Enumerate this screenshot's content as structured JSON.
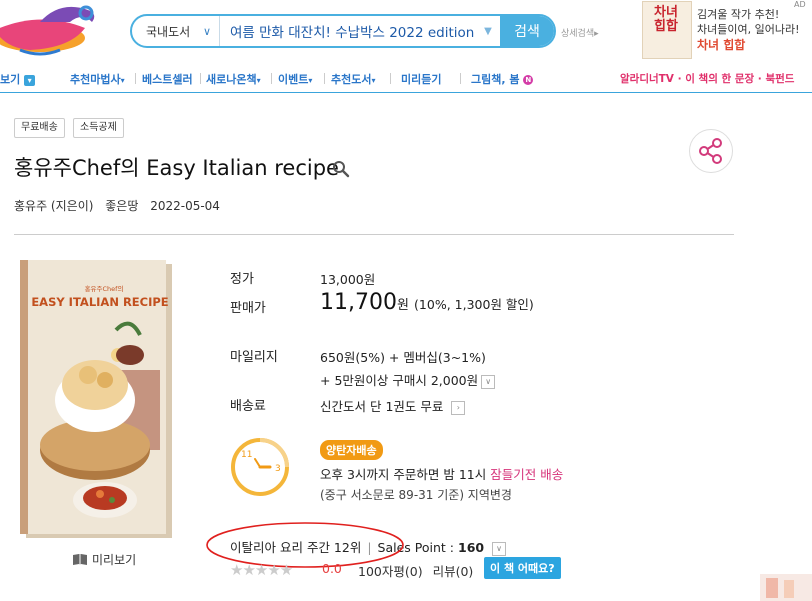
{
  "header": {
    "search": {
      "category": "국내도서",
      "value": "여름 만화 대잔치! 수납박스 2022 edition!",
      "button_label": "검색",
      "detail_label": "상세검색"
    },
    "ad": {
      "cover_text": "차녀 힙합",
      "line1": "김겨울 작가 추천!",
      "line2": "차녀들이여, 일어나라!",
      "title": "차녀 힙합",
      "mark": "AD"
    }
  },
  "nav": {
    "items": [
      {
        "label": "보기"
      },
      {
        "label": "추천마법사"
      },
      {
        "label": "베스트셀러"
      },
      {
        "label": "새로나온책"
      },
      {
        "label": "이벤트"
      },
      {
        "label": "추천도서"
      },
      {
        "label": "미리듣기"
      },
      {
        "label": "그림책, 봄"
      }
    ],
    "right_text": "알라디너TV · 이 책의 한 문장 · 북펀드"
  },
  "product": {
    "tags": [
      "무료배송",
      "소득공제"
    ],
    "title": "홍유주Chef의 Easy Italian recipe",
    "author": "홍유주 (지은이)",
    "publisher": "좋은땅",
    "date": "2022-05-04",
    "cover": {
      "small_title": "홍유주Chef의",
      "main_title": "EASY ITALIAN RECIPE"
    },
    "preview_label": "미리보기",
    "price": {
      "list_label": "정가",
      "list_value": "13,000원",
      "sale_label": "판매가",
      "sale_value": "11,700",
      "sale_unit": "원",
      "sale_discount": "(10%, 1,300원 할인)"
    },
    "mileage": {
      "label": "마일리지",
      "line1": "650원(5%) + 멤버십(3~1%)",
      "line2": "+ 5만원이상 구매시 2,000원"
    },
    "shipping": {
      "label": "배송료",
      "value": "신간도서 단 1권도 무료"
    },
    "delivery": {
      "badge": "양탄자배송",
      "line1_prefix": "오후 3시까지 주문하면 밤 11시 ",
      "line1_highlight": "잠들기전 배송",
      "line2": "(중구 서소문로 89-31 기준) 지역변경",
      "clock_11": "11",
      "clock_3": "3"
    },
    "rank": {
      "text": "이탈리아 요리 주간 12위",
      "sales_label": "Sales Point : ",
      "sales_value": "160"
    },
    "rating": {
      "stars": "★★★★★",
      "value": "0.0",
      "reviews_100": "100자평(0)",
      "reviews": "리뷰(0)",
      "why_button": "이 책 어때요?"
    }
  },
  "colors": {
    "accent_blue": "#3aa4dc",
    "delivery_orange": "#f19a14",
    "highlight_pink": "#d6347a",
    "annotation_red": "#e0201e"
  }
}
